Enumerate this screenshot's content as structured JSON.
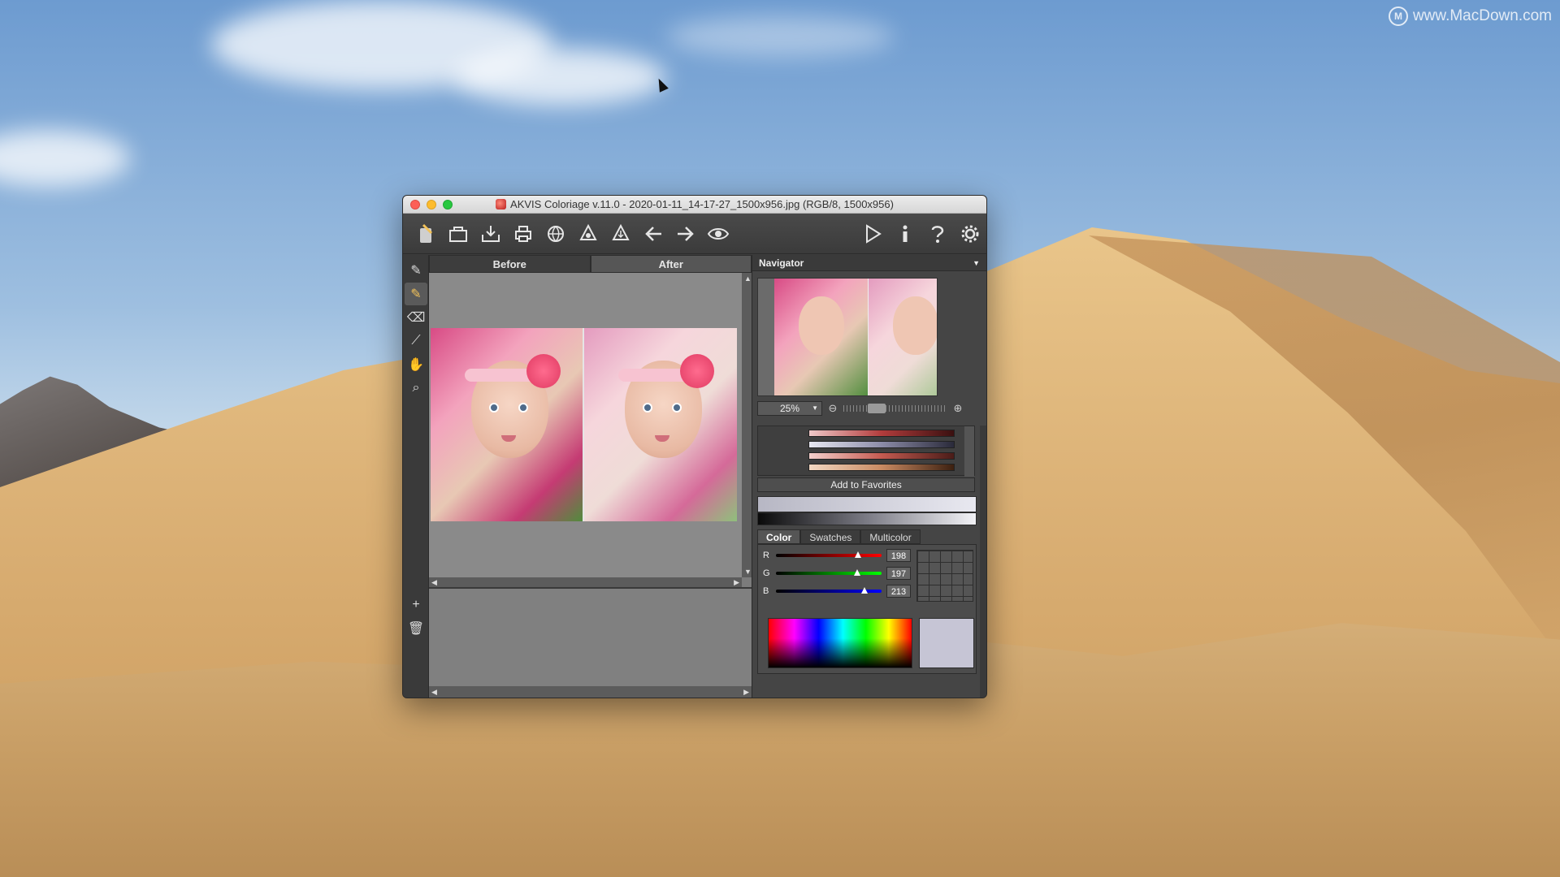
{
  "desktop": {
    "watermark": "www.MacDown.com",
    "watermark_logo": "M"
  },
  "window": {
    "title": "AKVIS Coloriage v.11.0 - 2020-01-11_14-17-27_1500x956.jpg (RGB/8, 1500x956)",
    "app_icon": "coloriage-app-icon"
  },
  "toolbar": {
    "icons": [
      "coloriage-logo-icon",
      "open-file-icon",
      "save-file-icon",
      "print-icon",
      "share-web-icon",
      "load-strokes-icon",
      "save-strokes-icon",
      "undo-arrow-icon",
      "redo-arrow-icon",
      "show-strokes-eye-icon",
      "run-play-icon",
      "info-icon",
      "help-icon",
      "settings-gear-icon"
    ]
  },
  "left_tools": {
    "icons": [
      "color-pencil-icon",
      "keep-color-pencil-icon",
      "eraser-icon",
      "eyedropper-icon",
      "hand-icon",
      "zoom-icon"
    ],
    "bottom_icons": [
      "add-plus-icon",
      "trash-icon"
    ]
  },
  "tabs": {
    "before": "Before",
    "after": "After"
  },
  "navigator": {
    "title": "Navigator",
    "zoom": "25%"
  },
  "favorites": {
    "add_label": "Add to Favorites"
  },
  "color_panel": {
    "tabs": [
      "Color",
      "Swatches",
      "Multicolor"
    ],
    "channels": [
      {
        "label": "R",
        "value": "198",
        "fraction": 0.776
      },
      {
        "label": "G",
        "value": "197",
        "fraction": 0.773
      },
      {
        "label": "B",
        "value": "213",
        "fraction": 0.835
      }
    ],
    "current_color": "#c6c5d5"
  },
  "colors": {
    "accent": "#f2c25a",
    "window_bg": "#3d3d3d"
  }
}
